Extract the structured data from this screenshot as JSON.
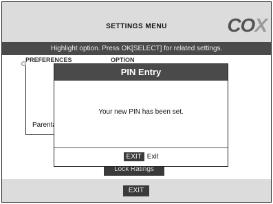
{
  "header": {
    "title": "SETTINGS MENU",
    "logo": "CO",
    "logo_x": "X"
  },
  "instruction": "Highlight option. Press OK[SELECT] for related settings.",
  "columns": {
    "preferences": "PREFERENCES",
    "options": "OPTION"
  },
  "tree": {
    "parent_label": "Parental"
  },
  "lock_ratings_label": "Lock Ratings",
  "footer": {
    "exit_label": "EXIT"
  },
  "dialog": {
    "title": "PIN Entry",
    "message": "Your new PIN has been set.",
    "exit_key": "EXIT",
    "exit_label": "Exit"
  }
}
